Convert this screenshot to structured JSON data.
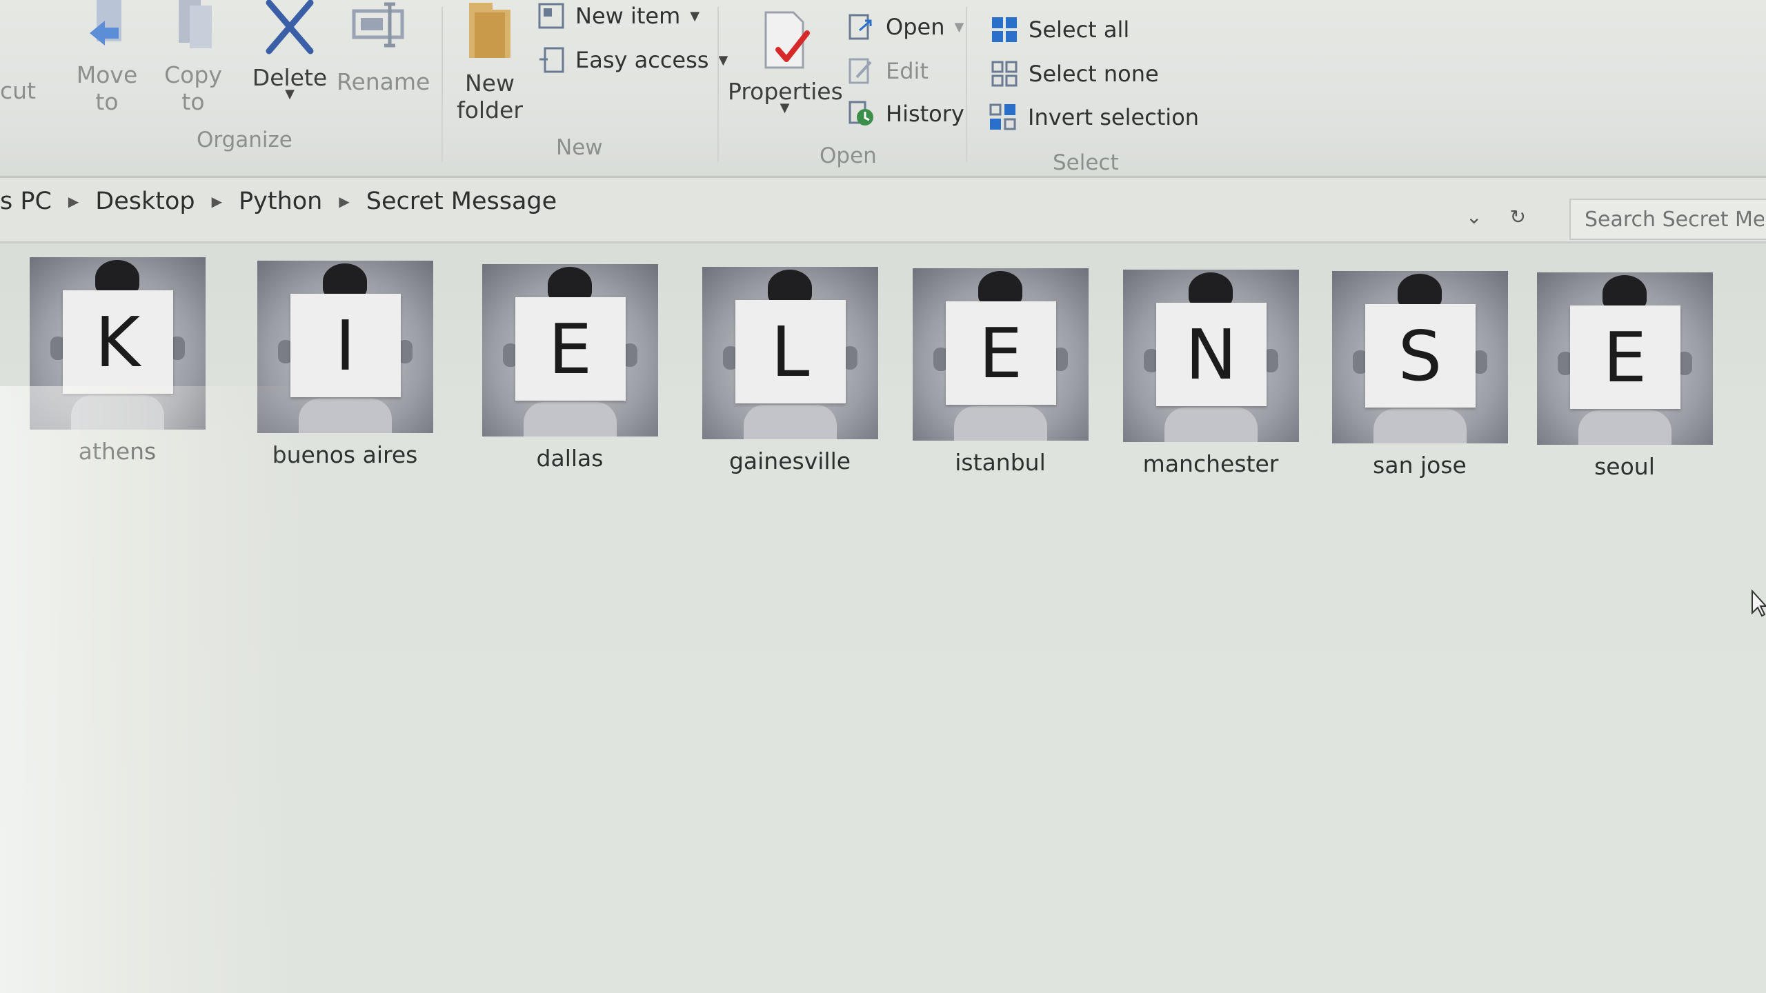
{
  "ribbon": {
    "clipboard": {
      "cut_label": "cut"
    },
    "organize": {
      "group_label": "Organize",
      "move_to": {
        "line1": "Move",
        "line2": "to"
      },
      "copy_to": {
        "line1": "Copy",
        "line2": "to"
      },
      "delete": "Delete",
      "rename": "Rename"
    },
    "new": {
      "group_label": "New",
      "new_folder": {
        "line1": "New",
        "line2": "folder"
      },
      "new_item": "New item",
      "easy_access": "Easy access"
    },
    "open": {
      "group_label": "Open",
      "properties": "Properties",
      "open": "Open",
      "edit": "Edit",
      "history": "History"
    },
    "select": {
      "group_label": "Select",
      "select_all": "Select all",
      "select_none": "Select none",
      "invert_selection": "Invert selection"
    }
  },
  "address": {
    "crumbs": [
      "s PC",
      "Desktop",
      "Python",
      "Secret Message"
    ]
  },
  "search": {
    "placeholder": "Search Secret Messa"
  },
  "files": [
    {
      "name": "athens",
      "letter": "K"
    },
    {
      "name": "buenos aires",
      "letter": "I"
    },
    {
      "name": "dallas",
      "letter": "E"
    },
    {
      "name": "gainesville",
      "letter": "L"
    },
    {
      "name": "istanbul",
      "letter": "E"
    },
    {
      "name": "manchester",
      "letter": "N"
    },
    {
      "name": "san jose",
      "letter": "S"
    },
    {
      "name": "seoul",
      "letter": "E"
    }
  ],
  "icons": {
    "move_to": "move-to-icon",
    "copy_to": "copy-to-icon",
    "delete": "delete-x-icon",
    "rename": "rename-icon",
    "new_folder": "folder-icon",
    "new_item": "new-item-icon",
    "easy_access": "easy-access-icon",
    "properties": "properties-check-icon",
    "open": "open-icon",
    "edit": "edit-icon",
    "history": "history-icon",
    "select_all": "select-all-icon",
    "select_none": "select-none-icon",
    "invert_selection": "invert-selection-icon"
  },
  "colors": {
    "delete_x": "#3b5fa6",
    "accent_blue": "#2a6fc9",
    "checkmark_red": "#d62a2a"
  }
}
